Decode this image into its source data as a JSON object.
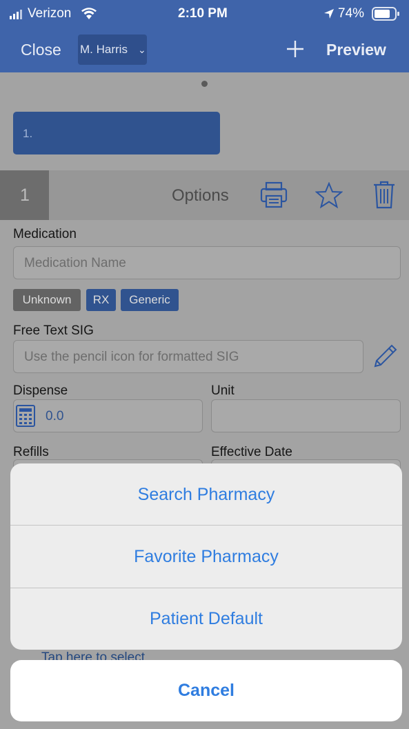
{
  "status": {
    "carrier": "Verizon",
    "time": "2:10 PM",
    "battery": "74%"
  },
  "nav": {
    "close": "Close",
    "provider": "M. Harris",
    "preview": "Preview"
  },
  "rx_tab": {
    "label": "1."
  },
  "rx": {
    "number": "1",
    "options": "Options",
    "medication_label": "Medication",
    "medication_placeholder": "Medication Name",
    "tags": [
      "Unknown",
      "RX",
      "Generic"
    ],
    "sig_label": "Free Text SIG",
    "sig_placeholder": "Use the pencil icon for formatted SIG",
    "dispense_label": "Dispense",
    "dispense_value": "0.0",
    "unit_label": "Unit",
    "refills_label": "Refills",
    "effective_label": "Effective Date",
    "pharmacy_hint": "Tap here to select"
  },
  "sheet": {
    "options": [
      "Search Pharmacy",
      "Favorite Pharmacy",
      "Patient Default"
    ],
    "cancel": "Cancel"
  }
}
